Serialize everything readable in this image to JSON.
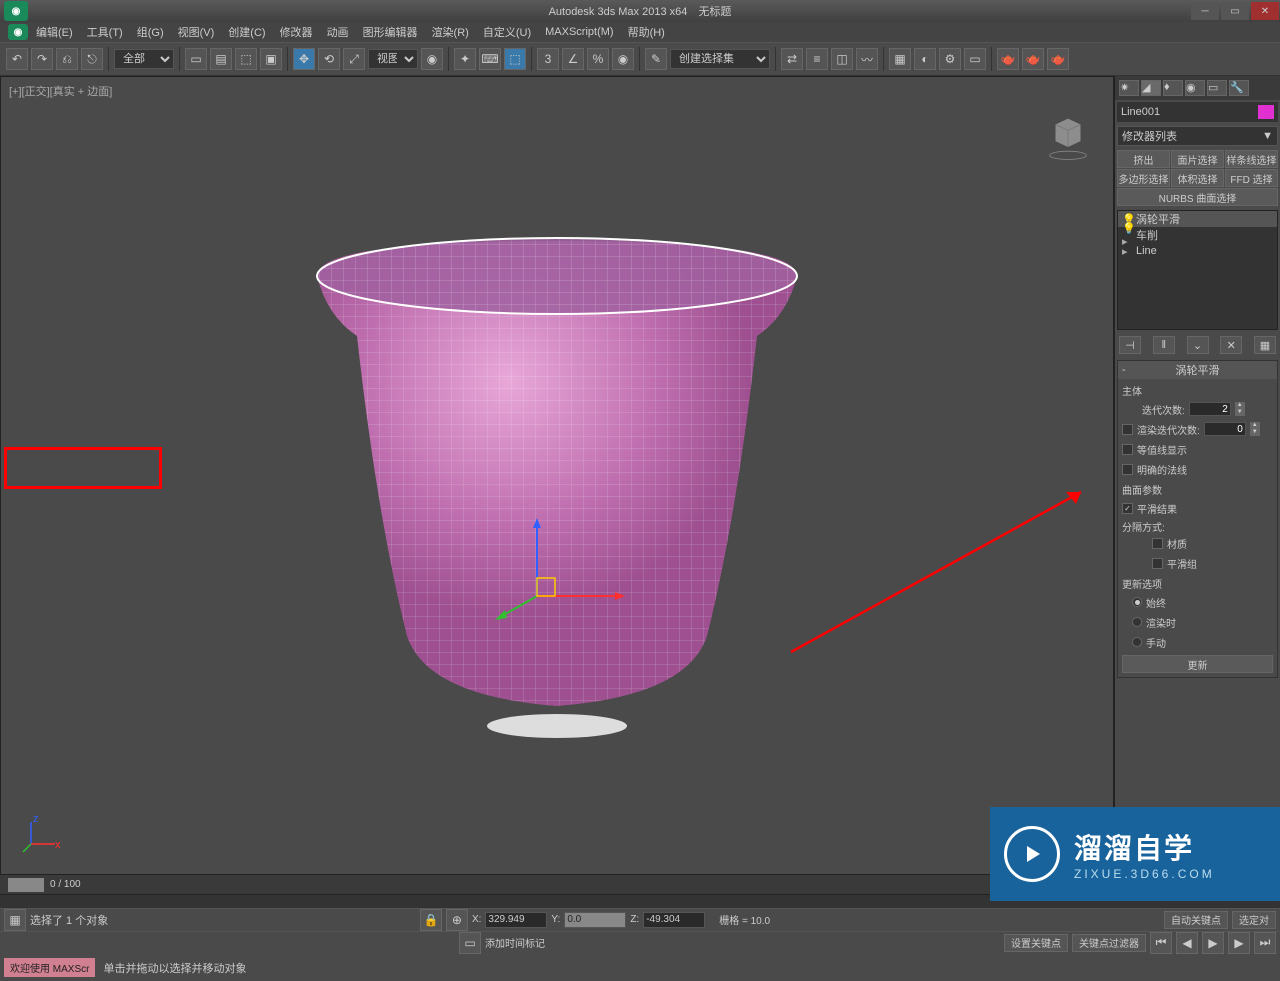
{
  "title": {
    "app": "Autodesk 3ds Max  2013 x64",
    "doc": "无标题"
  },
  "menu": [
    "编辑(E)",
    "工具(T)",
    "组(G)",
    "视图(V)",
    "创建(C)",
    "修改器",
    "动画",
    "图形编辑器",
    "渲染(R)",
    "自定义(U)",
    "MAXScript(M)",
    "帮助(H)"
  ],
  "toolbar": {
    "filter": "全部",
    "refcoord": "视图",
    "selset": "创建选择集"
  },
  "viewport": {
    "label": "[+][正交][真实 + 边面]"
  },
  "side": {
    "objName": "Line001",
    "modListLabel": "修改器列表",
    "buttons": [
      "挤出",
      "面片选择",
      "样条线选择",
      "多边形选择",
      "体积选择",
      "FFD 选择",
      "NURBS 曲面选择"
    ],
    "stack": [
      {
        "lbl": "涡轮平滑",
        "sel": true,
        "bulb": true
      },
      {
        "lbl": "车削",
        "sel": false,
        "bulb": true
      },
      {
        "lbl": "Line",
        "sel": false,
        "bulb": false
      }
    ],
    "rollout": {
      "title": "涡轮平滑",
      "mainLabel": "主体",
      "iterLabel": "迭代次数:",
      "iterVal": "2",
      "renderIterLabel": "渲染迭代次数:",
      "renderIterVal": "0",
      "isoline": "等值线显示",
      "normals": "明确的法线",
      "surfParams": "曲面参数",
      "smoothResult": "平滑结果",
      "sepMethod": "分隔方式:",
      "material": "材质",
      "smoothGroup": "平滑组",
      "updateOpts": "更新选项",
      "always": "始终",
      "onRender": "渲染时",
      "manual": "手动",
      "updateBtn": "更新"
    }
  },
  "timeline": {
    "frame": "0",
    "range": "0 / 100"
  },
  "status": {
    "sel": "选择了 1 个对象",
    "x": "329.949",
    "y": "0.0",
    "z": "-49.304",
    "grid": "栅格 = 10.0",
    "autoKey": "自动关键点",
    "selTrans": "选定对",
    "setKey": "设置关键点",
    "keyFilter": "关键点过滤器",
    "addTimeTag": "添加时间标记"
  },
  "prompt": {
    "welcome": "欢迎使用  MAXScr",
    "hint": "单击并拖动以选择并移动对象"
  },
  "watermark": {
    "main": "溜溜自学",
    "sub": "ZIXUE.3D66.COM"
  }
}
